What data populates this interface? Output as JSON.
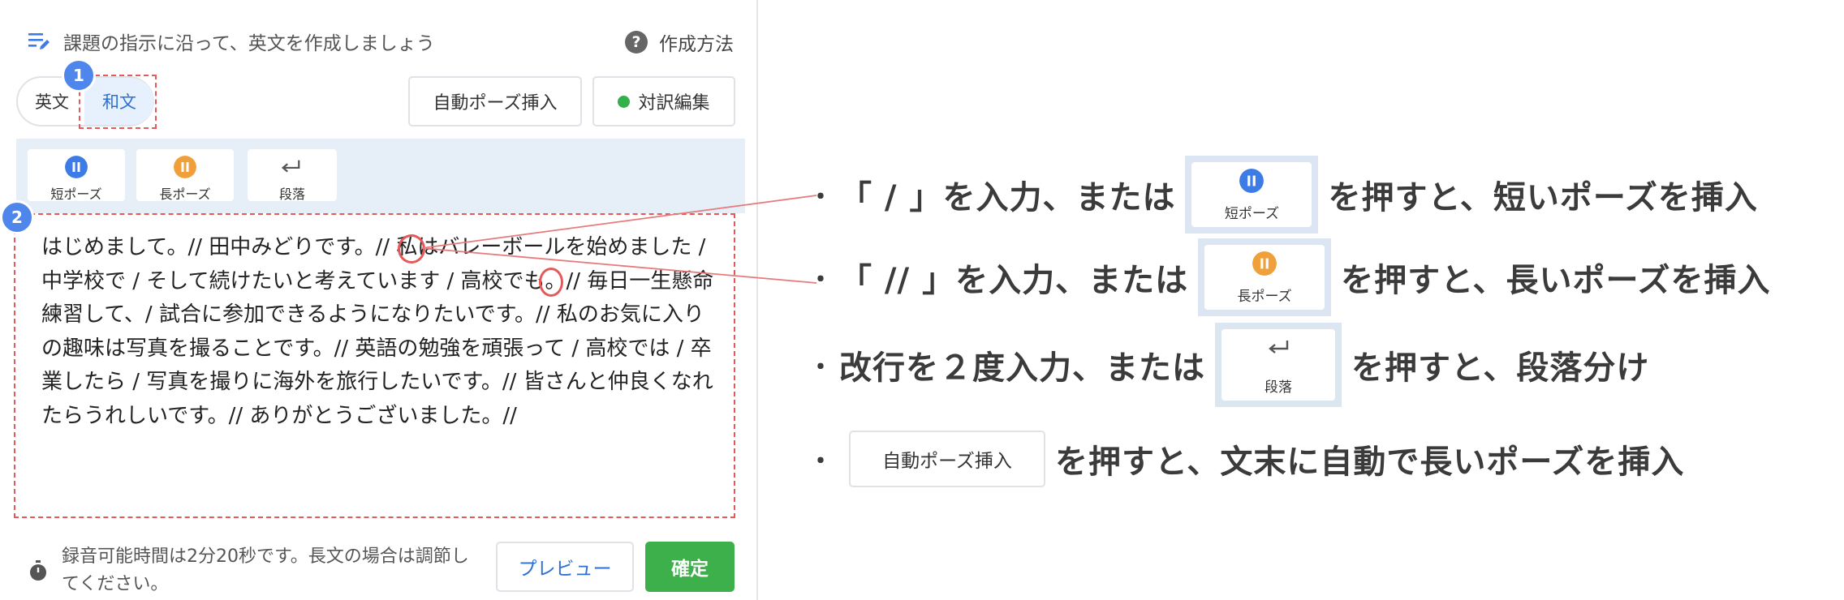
{
  "instruction": {
    "text": "課題の指示に沿って、英文を作成しましょう",
    "howto_label": "作成方法"
  },
  "lang_toggle": {
    "english": "英文",
    "japanese": "和文",
    "selected": "和文"
  },
  "markers": {
    "first": "1",
    "second": "2"
  },
  "actions": {
    "auto_pause": "自動ポーズ挿入",
    "parallel_edit": "対訳編集"
  },
  "toolbar": {
    "short_pause": "短ポーズ",
    "long_pause": "長ポーズ",
    "paragraph": "段落"
  },
  "editor": {
    "text": "はじめまして。// 田中みどりです。// 私はバレーボールを始めました / 中学校で / そして続けたいと考えています / 高校でも。// 毎日一生懸命練習して、/ 試合に参加できるようになりたいです。// 私のお気に入りの趣味は写真を撮ることです。// 英語の勉強を頑張って / 高校では / 卒業したら / 写真を撮りに海外を旅行したいです。// 皆さんと仲良くなれたらうれしいです。// ありがとうございました。//"
  },
  "footer": {
    "timer_text": "録音可能時間は2分20秒です。長文の場合は調節してください。",
    "preview": "プレビュー",
    "confirm": "確定"
  },
  "legend": {
    "bullet": "・",
    "line1_before": "「 / 」を入力、または",
    "line1_after": "を押すと、短いポーズを挿入",
    "line2_before": "「 // 」を入力、または",
    "line2_after": "を押すと、長いポーズを挿入",
    "line3_before": "改行を２度入力、または",
    "line3_after": "を押すと、段落分け",
    "line4_after": "を押すと、文末に自動で長いポーズを挿入",
    "sample_short": "短ポーズ",
    "sample_long": "長ポーズ",
    "sample_para": "段落",
    "sample_auto": "自動ポーズ挿入"
  },
  "colors": {
    "accent_blue": "#2d6fd2",
    "marker_blue": "#4e86ec",
    "short_pause_icon": "#3d7be6",
    "long_pause_icon": "#f0a03a",
    "confirm_green": "#3eb04b",
    "annotation_red": "#e45959",
    "toolbar_bg": "#e6eef7"
  }
}
